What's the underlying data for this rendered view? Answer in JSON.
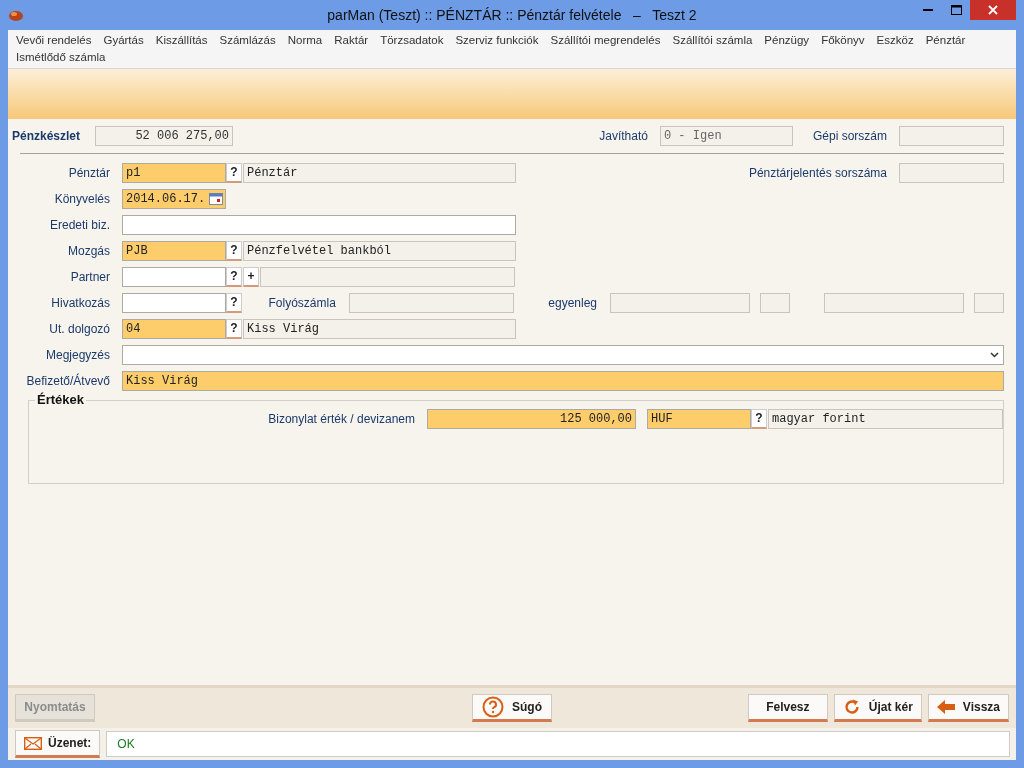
{
  "window": {
    "title": "parMan (Teszt) :: PÉNZTÁR :: Pénztár felvétele   –   Teszt 2"
  },
  "menu": [
    "Vevői rendelés",
    "Gyártás",
    "Kiszállítás",
    "Számlázás",
    "Norma",
    "Raktár",
    "Törzsadatok",
    "Szerviz funkciók",
    "Szállítói megrendelés",
    "Szállítói számla",
    "Pénzügy",
    "Főkönyv",
    "Eszköz",
    "Pénztár",
    "Ismétlődő számla"
  ],
  "header": {
    "balance_label": "Pénzkészlet",
    "balance": "52 006 275,00",
    "editable_label": "Javítható",
    "editable": "0 - Igen",
    "serial_label": "Gépi sorszám"
  },
  "fields": [
    {
      "kind": "lookup",
      "label": "Pénztár",
      "lookup": "?",
      "code": "p1",
      "description": "Pénztár",
      "required": true,
      "side_label": "Pénztárjelentés sorszáma"
    },
    {
      "kind": "date",
      "label": "Könyvelés",
      "value": "2014.06.17.",
      "required": true
    },
    {
      "kind": "text",
      "label": "Eredeti biz.",
      "required": false
    },
    {
      "kind": "lookup",
      "label": "Mozgás",
      "lookup": "?",
      "code": "PJB",
      "description": "Pénzfelvétel bankból",
      "required": true
    },
    {
      "kind": "partner",
      "label": "Partner",
      "lookup": "?",
      "add": "+",
      "required": false
    },
    {
      "kind": "reference",
      "label": "Hivatkozás",
      "lookup": "?",
      "required": false,
      "account_label": "Folyószámla",
      "balance_label": "egyenleg"
    },
    {
      "kind": "lookup",
      "label": "Ut. dolgozó",
      "lookup": "?",
      "code": "04",
      "description": "Kiss Virág",
      "required": true
    },
    {
      "kind": "dropdown",
      "label": "Megjegyzés",
      "required": false
    },
    {
      "kind": "wide",
      "label": "Befizető/Átvevő",
      "value": "Kiss Virág",
      "required": true
    }
  ],
  "values_group": {
    "title": "Értékek",
    "label": "Bizonylat érték  / devizanem",
    "amount": "125 000,00",
    "currency_code": "HUF",
    "lookup": "?",
    "currency_name": "magyar forint",
    "required": true
  },
  "footer_left": [
    {
      "label": "Nyomtatás",
      "kind": "plain",
      "disabled": true
    }
  ],
  "footer_center": [
    {
      "label": "Súgó",
      "kind": "help",
      "disabled": false
    }
  ],
  "footer_right": [
    {
      "label": "Felvesz",
      "kind": "plain",
      "disabled": false
    },
    {
      "label": "Újat kér",
      "kind": "refresh",
      "disabled": false
    },
    {
      "label": "Vissza",
      "kind": "back",
      "disabled": false
    }
  ],
  "message": {
    "label": "Üzenet:",
    "text": "OK"
  }
}
